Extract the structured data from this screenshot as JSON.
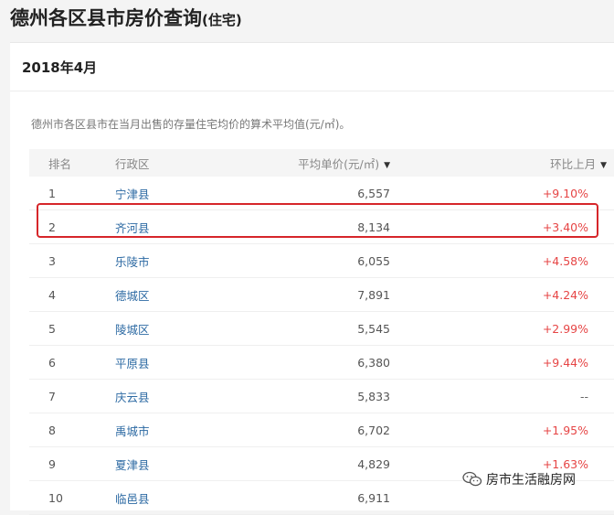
{
  "header": {
    "title": "德州各区县市房价查询",
    "title_suffix": "(住宅)"
  },
  "card": {
    "period": "2018年4月",
    "description": "德州市各区县市在当月出售的存量住宅均价的算术平均值(元/㎡)。"
  },
  "table": {
    "columns": {
      "rank": "排名",
      "district": "行政区",
      "avg_price": "平均单价(元/㎡)",
      "mom": "环比上月"
    },
    "sort_icon": "triangle-down-icon",
    "rows": [
      {
        "rank": "1",
        "district": "宁津县",
        "price": "6,557",
        "change": "+9.10%"
      },
      {
        "rank": "2",
        "district": "齐河县",
        "price": "8,134",
        "change": "+3.40%"
      },
      {
        "rank": "3",
        "district": "乐陵市",
        "price": "6,055",
        "change": "+4.58%"
      },
      {
        "rank": "4",
        "district": "德城区",
        "price": "7,891",
        "change": "+4.24%"
      },
      {
        "rank": "5",
        "district": "陵城区",
        "price": "5,545",
        "change": "+2.99%"
      },
      {
        "rank": "6",
        "district": "平原县",
        "price": "6,380",
        "change": "+9.44%"
      },
      {
        "rank": "7",
        "district": "庆云县",
        "price": "5,833",
        "change": "--"
      },
      {
        "rank": "8",
        "district": "禹城市",
        "price": "6,702",
        "change": "+1.95%"
      },
      {
        "rank": "9",
        "district": "夏津县",
        "price": "4,829",
        "change": "+1.63%"
      },
      {
        "rank": "10",
        "district": "临邑县",
        "price": "6,911",
        "change": ""
      }
    ]
  },
  "watermark": {
    "text": "房市生活融房网",
    "icon": "wechat-icon"
  },
  "colors": {
    "link": "#2d6aa3",
    "increase": "#e64545",
    "highlight": "#d6262a"
  }
}
